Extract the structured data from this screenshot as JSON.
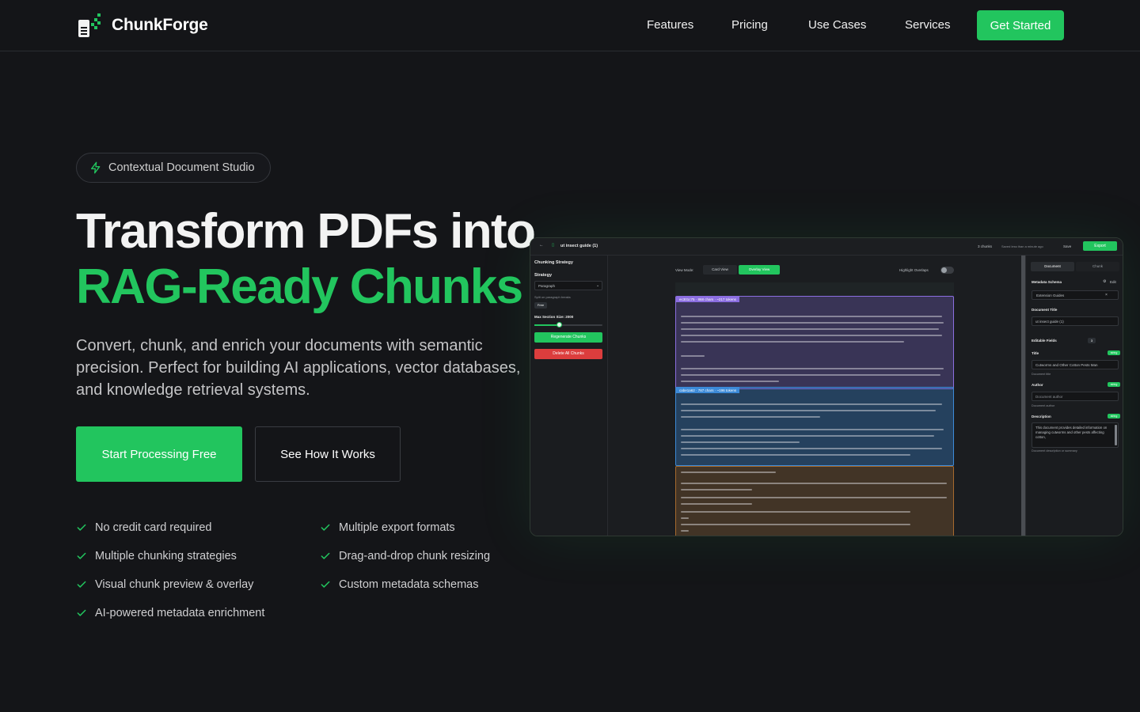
{
  "brand": {
    "name": "ChunkForge",
    "accent": "#22c55e",
    "background": "#141518"
  },
  "nav": {
    "links": [
      "Features",
      "Pricing",
      "Use Cases",
      "Services"
    ],
    "cta": "Get Started"
  },
  "hero": {
    "badge": "Contextual Document Studio",
    "title_line1": "Transform PDFs into",
    "title_line2": "RAG-Ready Chunks",
    "subtitle": "Convert, chunk, and enrich your documents with semantic precision. Perfect for building AI applications, vector databases, and knowledge retrieval systems.",
    "primary_cta": "Start Processing Free",
    "secondary_cta": "See How It Works",
    "features": [
      "No credit card required",
      "Multiple export formats",
      "Multiple chunking strategies",
      "Drag-and-drop chunk resizing",
      "Visual chunk preview & overlay",
      "Custom metadata schemas",
      "AI-powered metadata enrichment"
    ]
  },
  "screenshot": {
    "doc_title": "ut insect guide (1)",
    "chunks_count": "3 chunks",
    "saved": "Saved less than a minute ago",
    "save": "Save",
    "export": "Export",
    "left": {
      "heading": "Chunking Strategy",
      "strategy_label": "Strategy",
      "strategy_value": "Paragraph",
      "hint": "Split on paragraph breaks",
      "pill": "Free",
      "max_label": "Max Section Size: 2000",
      "regenerate": "Regenerate Chunks",
      "delete": "Delete All Chunks"
    },
    "center": {
      "view_mode": "View Mode:",
      "card_view": "Card View",
      "overlay_view": "Overlay View",
      "highlight": "Highlight Overlaps",
      "chunk1_tag": "ec301c75 · 868 chars · ~217 tokens",
      "chunk2_tag": "cabe1a62 · 787 chars · ~196 tokens"
    },
    "right": {
      "tab_document": "Document",
      "tab_chunk": "Chunk",
      "schema_label": "Metadata Schema",
      "edit": "Edit",
      "schema_value": "Extension Guides",
      "doc_title_label": "Document Title",
      "doc_title_value": "ut insect guide (1)",
      "editable_fields": "Editable Fields",
      "editable_count": "3",
      "title_label": "Title",
      "title_value": "Cutworms and Other Cotton Pests Man",
      "title_hint": "Document title",
      "author_label": "Author",
      "author_placeholder": "Document author",
      "author_hint": "Document author",
      "desc_label": "Description",
      "desc_value": "This document provides detailed information on managing cutworms and other pests affecting cotton,",
      "desc_hint": "Document description or summary",
      "type_badge": "string"
    }
  }
}
